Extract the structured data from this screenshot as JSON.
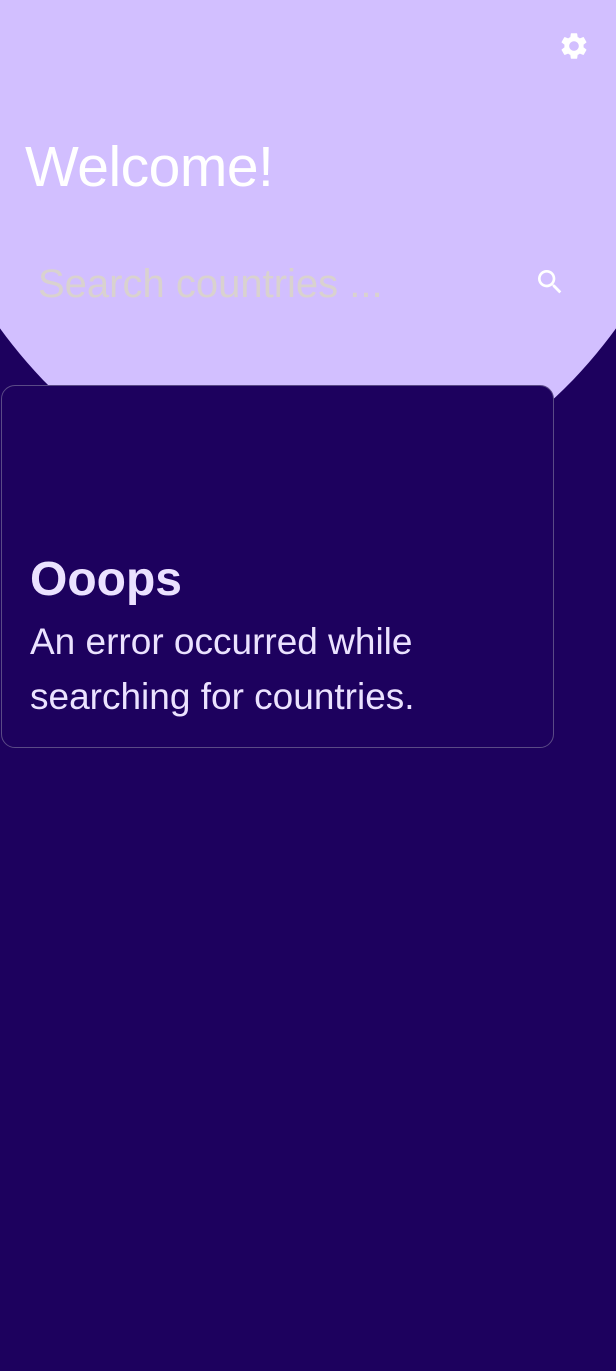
{
  "header": {
    "title": "Welcome!",
    "settings_icon": "gear-icon"
  },
  "search": {
    "placeholder": "Search countries ...",
    "value": "",
    "icon": "search-icon"
  },
  "error": {
    "title": "Ooops",
    "message": "An error occurred while searching for countries."
  },
  "colors": {
    "background": "#1d015e",
    "header_background": "#d2bfff",
    "card_border": "#5a4a86",
    "text_on_dark": "#ebe2ff",
    "text_on_light": "#ffffff",
    "placeholder": "#d9d2cf"
  }
}
